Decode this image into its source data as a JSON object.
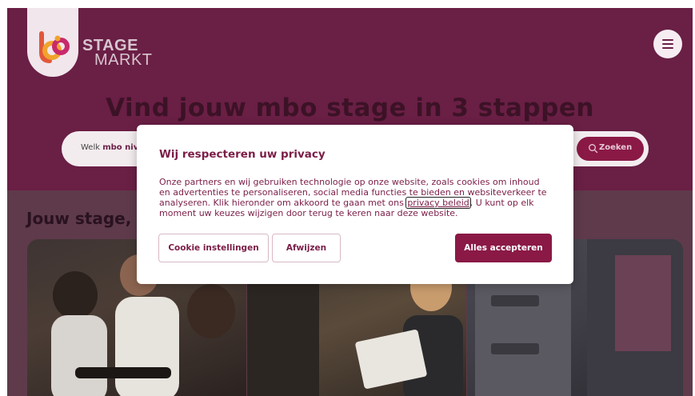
{
  "header": {
    "logo_line1": "STAGE",
    "logo_line2": "MARKT",
    "menu_icon": "hamburger-menu-icon"
  },
  "hero": {
    "title": "Vind jouw mbo stage in 3 stappen",
    "search_label_prefix": "Welk",
    "search_label_bold": "mbo nivea",
    "search_button": "Zoeken"
  },
  "section": {
    "title": "Jouw stage, v"
  },
  "privacy_modal": {
    "title": "Wij respecteren uw privacy",
    "text_before_link": "Onze partners en wij gebruiken technologie op onze website, zoals cookies om inhoud en advertenties te personaliseren, social media functies te bieden en websiteverkeer te analyseren. Klik hieronder om akkoord te gaan met ons ",
    "link_text": "privacy beleid",
    "text_after_link": ". U kunt op elk moment uw keuzes wijzigen door terug te keren naar deze website.",
    "button_settings": "Cookie instellingen",
    "button_reject": "Afwijzen",
    "button_accept": "Alles accepteren"
  },
  "colors": {
    "brand": "#8a1946",
    "hero_bg": "#6a1f45",
    "modal_text": "#7b1d47"
  }
}
